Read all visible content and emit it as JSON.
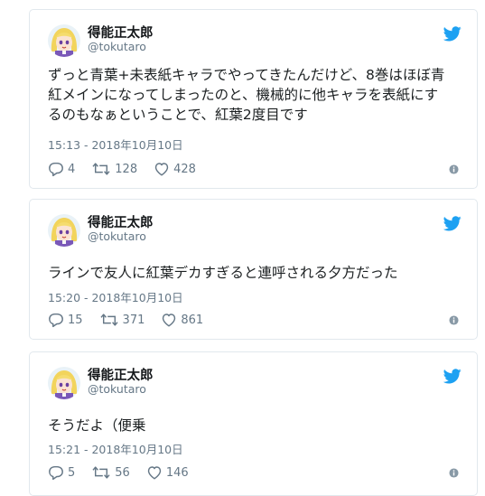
{
  "tweets": [
    {
      "display_name": "得能正太郎",
      "handle": "@tokutaro",
      "text": "ずっと青葉+未表紙キャラでやってきたんだけど、8巻はほぼ青\n紅メインになってしまったのと、機械的に他キャラを表紙にす\nるのもなぁということで、紅葉2度目です",
      "timestamp": "15:13 - 2018年10月10日",
      "replies": "4",
      "retweets": "128",
      "likes": "428"
    },
    {
      "display_name": "得能正太郎",
      "handle": "@tokutaro",
      "text": "ラインで友人に紅葉デカすぎると連呼される夕方だった",
      "timestamp": "15:20 - 2018年10月10日",
      "replies": "15",
      "retweets": "371",
      "likes": "861"
    },
    {
      "display_name": "得能正太郎",
      "handle": "@tokutaro",
      "text": "そうだよ（便乗",
      "timestamp": "15:21 - 2018年10月10日",
      "replies": "5",
      "retweets": "56",
      "likes": "146"
    }
  ],
  "colors": {
    "twitter_blue": "#1da1f2",
    "secondary_text": "#657786",
    "border": "#e1e8ed"
  },
  "icons": [
    "twitter-bird-icon",
    "reply-icon",
    "retweet-icon",
    "heart-icon",
    "info-icon"
  ]
}
